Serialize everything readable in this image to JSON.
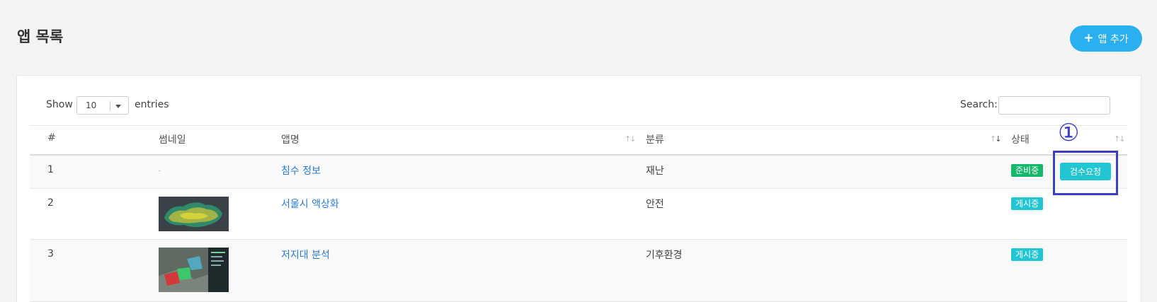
{
  "page": {
    "title": "앱 목록",
    "add_button": {
      "label": "앱 추가",
      "icon": "plus-icon"
    }
  },
  "table_controls": {
    "show_label": "Show",
    "page_length": "10",
    "entries_label": "entries",
    "search_label": "Search:",
    "search_value": ""
  },
  "table": {
    "columns": [
      {
        "key": "num",
        "label": "#"
      },
      {
        "key": "thumbnail",
        "label": "썸네일"
      },
      {
        "key": "app_name",
        "label": "앱명"
      },
      {
        "key": "category",
        "label": "분류"
      },
      {
        "key": "status",
        "label": "상태"
      }
    ],
    "rows": [
      {
        "num": "1",
        "thumbnail": "",
        "app_name": "침수 정보",
        "category": "재난",
        "status": "준비중",
        "action": "검수요청"
      },
      {
        "num": "2",
        "thumbnail": "map-thumbnail",
        "app_name": "서울시 액상화",
        "category": "안전",
        "status": "게시중"
      },
      {
        "num": "3",
        "thumbnail": "aerial-thumbnail",
        "app_name": "저지대 분석",
        "category": "기후환경",
        "status": "게시중"
      }
    ]
  },
  "annotation": {
    "marker": "①"
  },
  "colors": {
    "accent": "#2ab0f0",
    "link": "#2b7bd6",
    "ready": "#14b86a",
    "published": "#22c5d3",
    "annotation": "#3a3fc4"
  }
}
